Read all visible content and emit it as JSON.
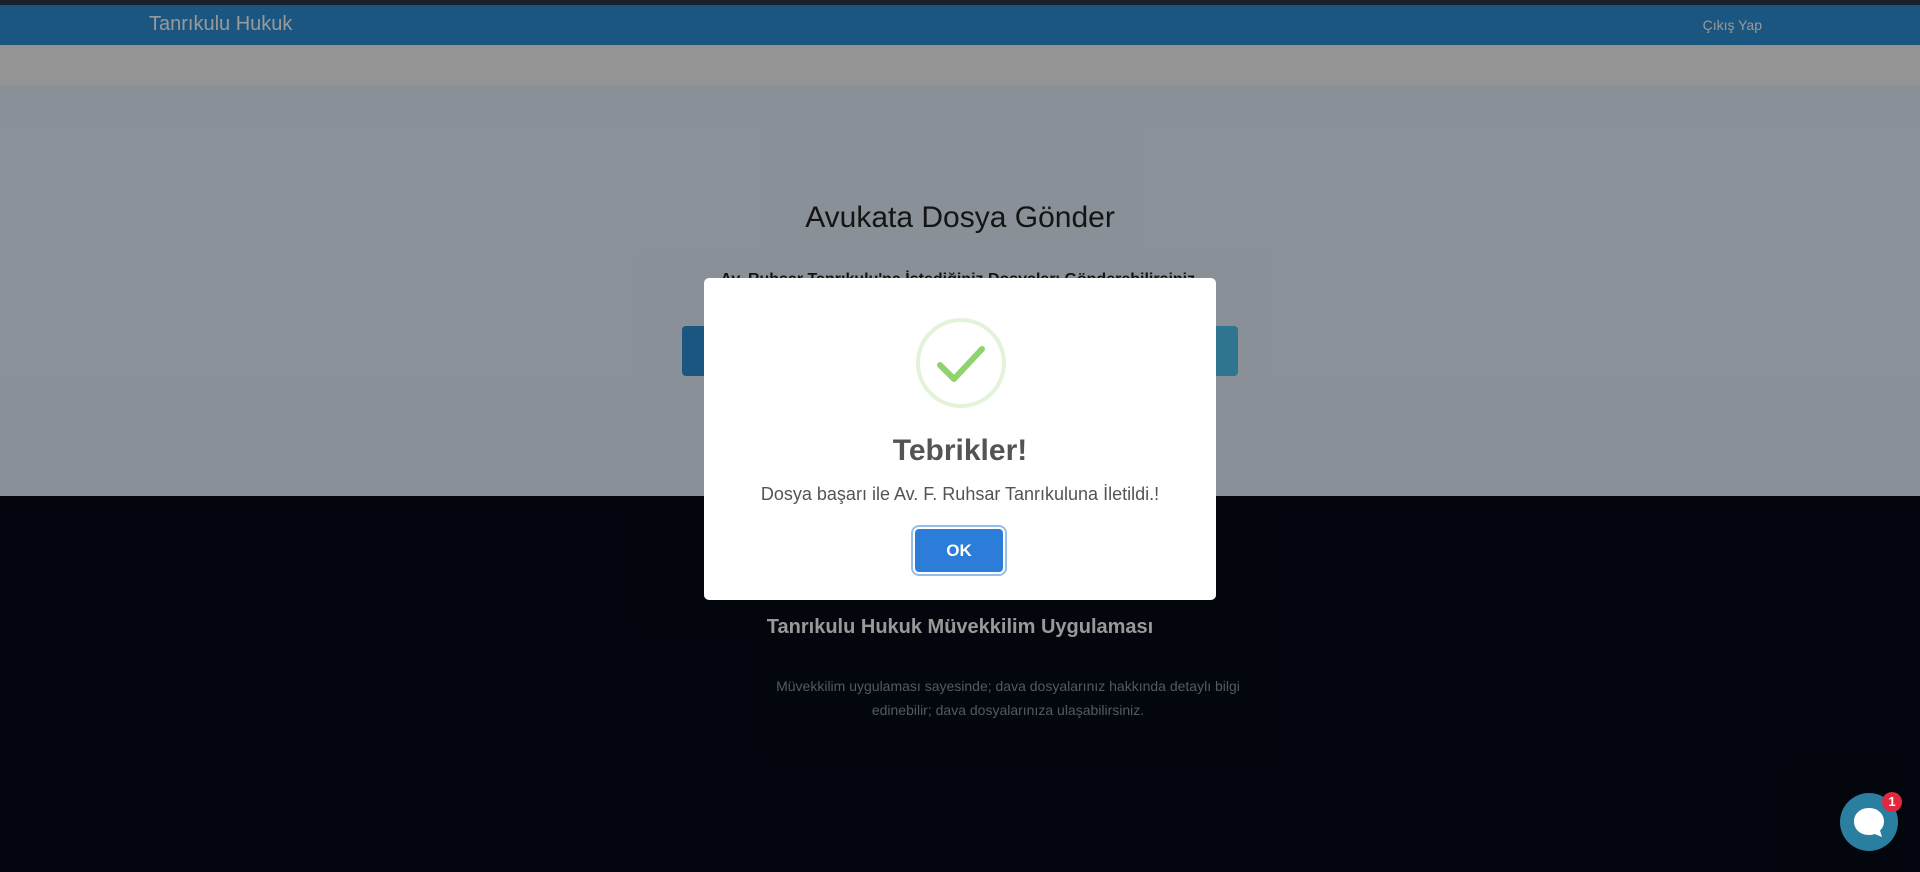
{
  "navbar": {
    "brand": "Tanrıkulu Hukuk",
    "logout": "Çıkış Yap"
  },
  "hero": {
    "title": "Avukata Dosya Gönder",
    "subtitle": "Av. Ruhsar Tanrıkulu'na İstediğiniz Dosyaları Gönderebilirsiniz."
  },
  "footer": {
    "title": "Tanrıkulu Hukuk Müvekkilim Uygulaması",
    "text": "Müvekkilim uygulaması sayesinde; dava dosyalarınız hakkında detaylı bilgi edinebilir; dava dosyalarınıza ulaşabilirsiniz."
  },
  "dialog": {
    "icon": "success-check-icon",
    "title": "Tebrikler!",
    "message": "Dosya başarı ile Av. F. Ruhsar Tanrıkuluna İletildi.!",
    "ok_label": "OK"
  },
  "chat": {
    "icon": "chat-bubble-icon",
    "badge_count": "1"
  },
  "colors": {
    "navbar": "#2e8fd6",
    "confirm_button": "#2c7dd9",
    "success": "#8ed36c",
    "badge": "#e0283e"
  }
}
